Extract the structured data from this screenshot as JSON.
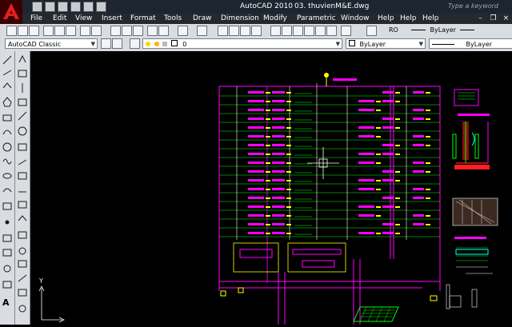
{
  "titlebar": {
    "app": "AutoCAD 2010",
    "file": "03. thuvienM&E.dwg",
    "search": "Type a keyword"
  },
  "menu": [
    "File",
    "Edit",
    "View",
    "Insert",
    "Format",
    "Tools",
    "Draw",
    "Dimension",
    "Modify",
    "Parametric",
    "Window",
    "Help",
    "Help",
    "Help"
  ],
  "toolbar": {
    "workspace": "AutoCAD Classic",
    "layer_value": "0",
    "layer_sample": "ByLayer",
    "color": "ByLayer",
    "linetype": "ByLayer",
    "text_style": "RO",
    "plot_style": "ByLayer"
  },
  "colors": {
    "magenta": "#ff00ff",
    "green": "#00ff00",
    "white": "#ffffff",
    "cyan": "#00ffff",
    "yellow": "#ffff00",
    "red": "#ff2020"
  }
}
